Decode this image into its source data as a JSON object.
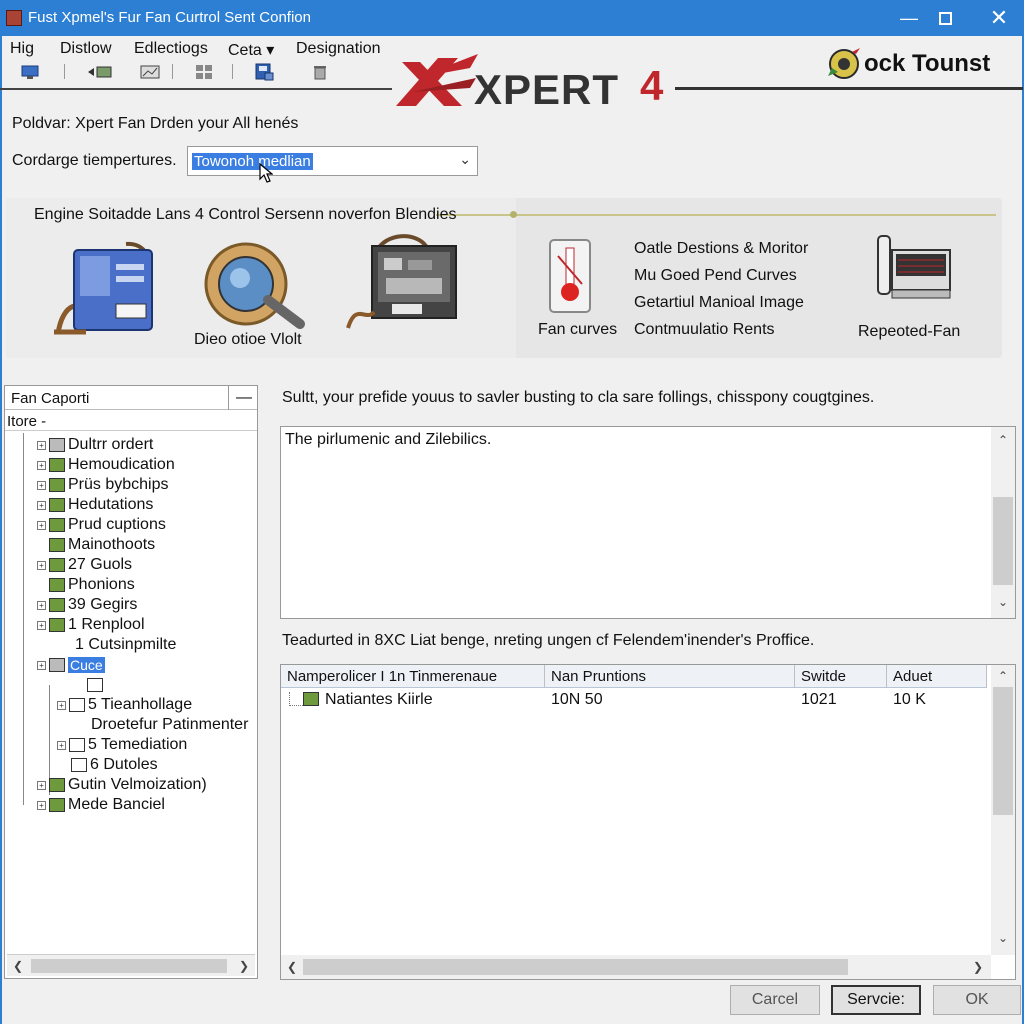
{
  "window": {
    "title": "Fust Xpmel's Fur Fan Curtrol Sent Confion",
    "accent_color": "#2d7fd3",
    "minimize_icon": "minimize-icon",
    "maximize_icon": "maximize-icon",
    "close_icon": "close-icon"
  },
  "menu": {
    "items": [
      "Hig",
      "Distlow",
      "Edlectiogs",
      "Ceta",
      "Designation"
    ],
    "ceta_caret": "▾"
  },
  "toolbar": {
    "icons": [
      "monitor-icon",
      "arrow-monitor-icon",
      "chart-icon",
      "grid-icon",
      "save-icon",
      "trash-icon"
    ]
  },
  "branding": {
    "xpert_text": "XPERT",
    "version": "4",
    "lock_text": "ock Tounst",
    "logo_color": "#c0272d"
  },
  "settings": {
    "folder_label": "Poldvar: Xpert Fan Drden your All henés",
    "temperature_label": "Cordarge tiempertures.",
    "temperature_value": "Towonoh medlian"
  },
  "features": {
    "header": "Engine Soitadde Lans 4 Control Sersenn noverfon Blendies",
    "items": [
      {
        "icon": "device-icon",
        "caption": ""
      },
      {
        "icon": "magnifier-icon",
        "caption": "Dieo otioe Vlolt"
      },
      {
        "icon": "circuit-board-icon",
        "caption": ""
      },
      {
        "icon": "thermometer-icon",
        "caption": "Fan curves"
      },
      {
        "icon": "fan-unit-icon",
        "caption": "Repeoted-Fan"
      }
    ],
    "options": [
      "Oatle Destions & Moritor",
      "Mu Goed Pend Curves",
      "Getartiul Manioal Image",
      "Contmuulatio Rents"
    ]
  },
  "tree": {
    "title": "Fan Caporti",
    "filter": "Itore -",
    "nodes": [
      "Dultrr ordert",
      "Hemoudication",
      "Prüs bybchips",
      "Hedutations",
      "Prud cuptions",
      "Mainothoots",
      "27 Guols",
      "Phonions",
      "39 Gegirs",
      "1 Renplool",
      "1 Cutsinpmilte",
      "Cuce",
      "5 Tieanhollage",
      "Droetefur Patinmenter",
      "5 Temediation",
      "6 Dutoles",
      "Gutin Velmoization)",
      "Mede Banciel"
    ]
  },
  "description": {
    "label": "Sultt, your prefide youus to savler busting to cla sare follings, chisspony cougtgines.",
    "text": "The pirlumenic and Zilebilics."
  },
  "table": {
    "label": "Teadurted in 8XC Liat benge, nreting ungen cf Felendem'inender's Proffice.",
    "columns": [
      "Namperolicer I 1n Tinmerenaue",
      "Nan Pruntions",
      "Switde",
      "Aduet"
    ],
    "rows": [
      [
        "Natiantes Kiirle",
        "10N 50",
        "1021",
        "10 K"
      ]
    ]
  },
  "buttons": {
    "cancel": "Carcel",
    "service": "Servcie:",
    "ok": "OK"
  }
}
